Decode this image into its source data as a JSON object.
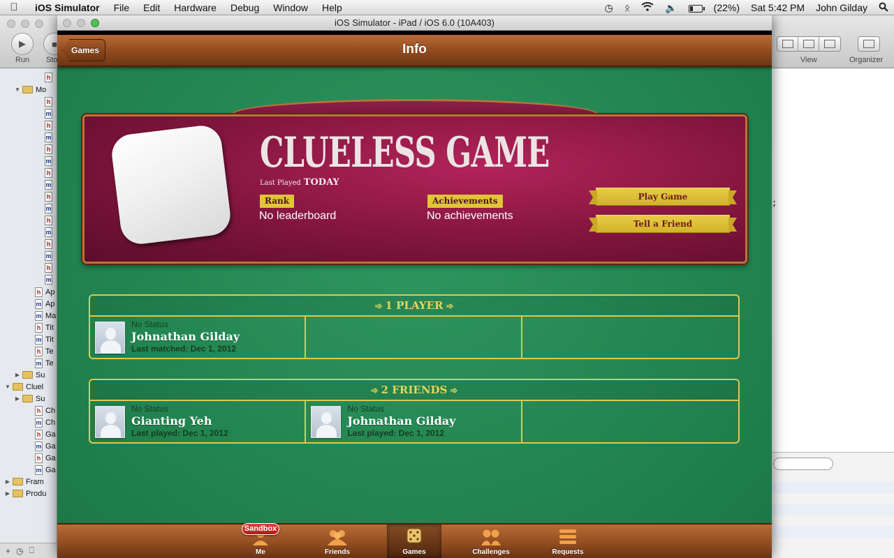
{
  "menubar": {
    "app_name": "iOS Simulator",
    "menus": [
      "File",
      "Edit",
      "Hardware",
      "Debug",
      "Window",
      "Help"
    ],
    "battery": "(22%)",
    "clock": "Sat 5:42 PM",
    "user": "John Gilday"
  },
  "xcode": {
    "toolbar": {
      "run_label": "Run",
      "stop_label": "Sto",
      "view_label": "View",
      "organizer_label": "Organizer"
    },
    "tree": [
      {
        "type": "h",
        "label": ""
      },
      {
        "type": "folder",
        "label": "Mo"
      },
      {
        "type": "h",
        "label": ""
      },
      {
        "type": "m",
        "label": ""
      },
      {
        "type": "h",
        "label": ""
      },
      {
        "type": "m",
        "label": ""
      },
      {
        "type": "h",
        "label": ""
      },
      {
        "type": "m",
        "label": ""
      },
      {
        "type": "h",
        "label": ""
      },
      {
        "type": "m",
        "label": ""
      },
      {
        "type": "h",
        "label": ""
      },
      {
        "type": "m",
        "label": ""
      },
      {
        "type": "h",
        "label": ""
      },
      {
        "type": "m",
        "label": ""
      },
      {
        "type": "h",
        "label": ""
      },
      {
        "type": "m",
        "label": ""
      },
      {
        "type": "h",
        "label": ""
      },
      {
        "type": "m",
        "label": ""
      },
      {
        "type": "h",
        "label": "Ap"
      },
      {
        "type": "m",
        "label": "Ap"
      },
      {
        "type": "m",
        "label": "Ma"
      },
      {
        "type": "h",
        "label": "Tit"
      },
      {
        "type": "m",
        "label": "Tit"
      },
      {
        "type": "h",
        "label": "Te"
      },
      {
        "type": "m",
        "label": "Te"
      },
      {
        "type": "folder",
        "label": "Su"
      },
      {
        "type": "folder",
        "label": "Cluel"
      },
      {
        "type": "folder",
        "label": "Su"
      },
      {
        "type": "h",
        "label": "Ch"
      },
      {
        "type": "m",
        "label": "Ch"
      },
      {
        "type": "h",
        "label": "Ga"
      },
      {
        "type": "m",
        "label": "Ga"
      },
      {
        "type": "h",
        "label": "Ga"
      },
      {
        "type": "m",
        "label": "Ga"
      },
      {
        "type": "folder",
        "label": "Fram"
      },
      {
        "type": "folder",
        "label": "Produ"
      }
    ],
    "editor_text": ";"
  },
  "simulator": {
    "window_title": "iOS Simulator - iPad / iOS 6.0 (10A403)",
    "nav": {
      "title": "Info",
      "back_label": "Games"
    },
    "game": {
      "title": "CLUELESS GAME",
      "last_played_label": "Last Played",
      "last_played_value": "TODAY",
      "rank_label": "Rank",
      "rank_value": "No leaderboard",
      "achievements_label": "Achievements",
      "achievements_value": "No achievements",
      "play_button": "Play Game",
      "tell_button": "Tell a Friend"
    },
    "players_section": {
      "heading": "1 PLAYER",
      "players": [
        {
          "status": "No Status",
          "name": "Johnathan Gilday",
          "date": "Last matched: Dec 1, 2012"
        }
      ]
    },
    "friends_section": {
      "heading": "2 FRIENDS",
      "friends": [
        {
          "status": "No Status",
          "name": "Gianting Yeh",
          "date": "Last played: Dec 1, 2012"
        },
        {
          "status": "No Status",
          "name": "Johnathan Gilday",
          "date": "Last played: Dec 1, 2012"
        }
      ]
    },
    "tabbar": {
      "badge": "Sandbox",
      "tabs": [
        {
          "label": "Me",
          "icon": "me-icon"
        },
        {
          "label": "Friends",
          "icon": "friends-icon"
        },
        {
          "label": "Games",
          "icon": "dice-icon",
          "selected": true
        },
        {
          "label": "Challenges",
          "icon": "challenges-icon"
        },
        {
          "label": "Requests",
          "icon": "requests-icon"
        }
      ]
    }
  },
  "colors": {
    "felt_green": "#238652",
    "wood": "#8f4a1f",
    "card_maroon": "#85163f",
    "accent_gold": "#e2c437"
  }
}
